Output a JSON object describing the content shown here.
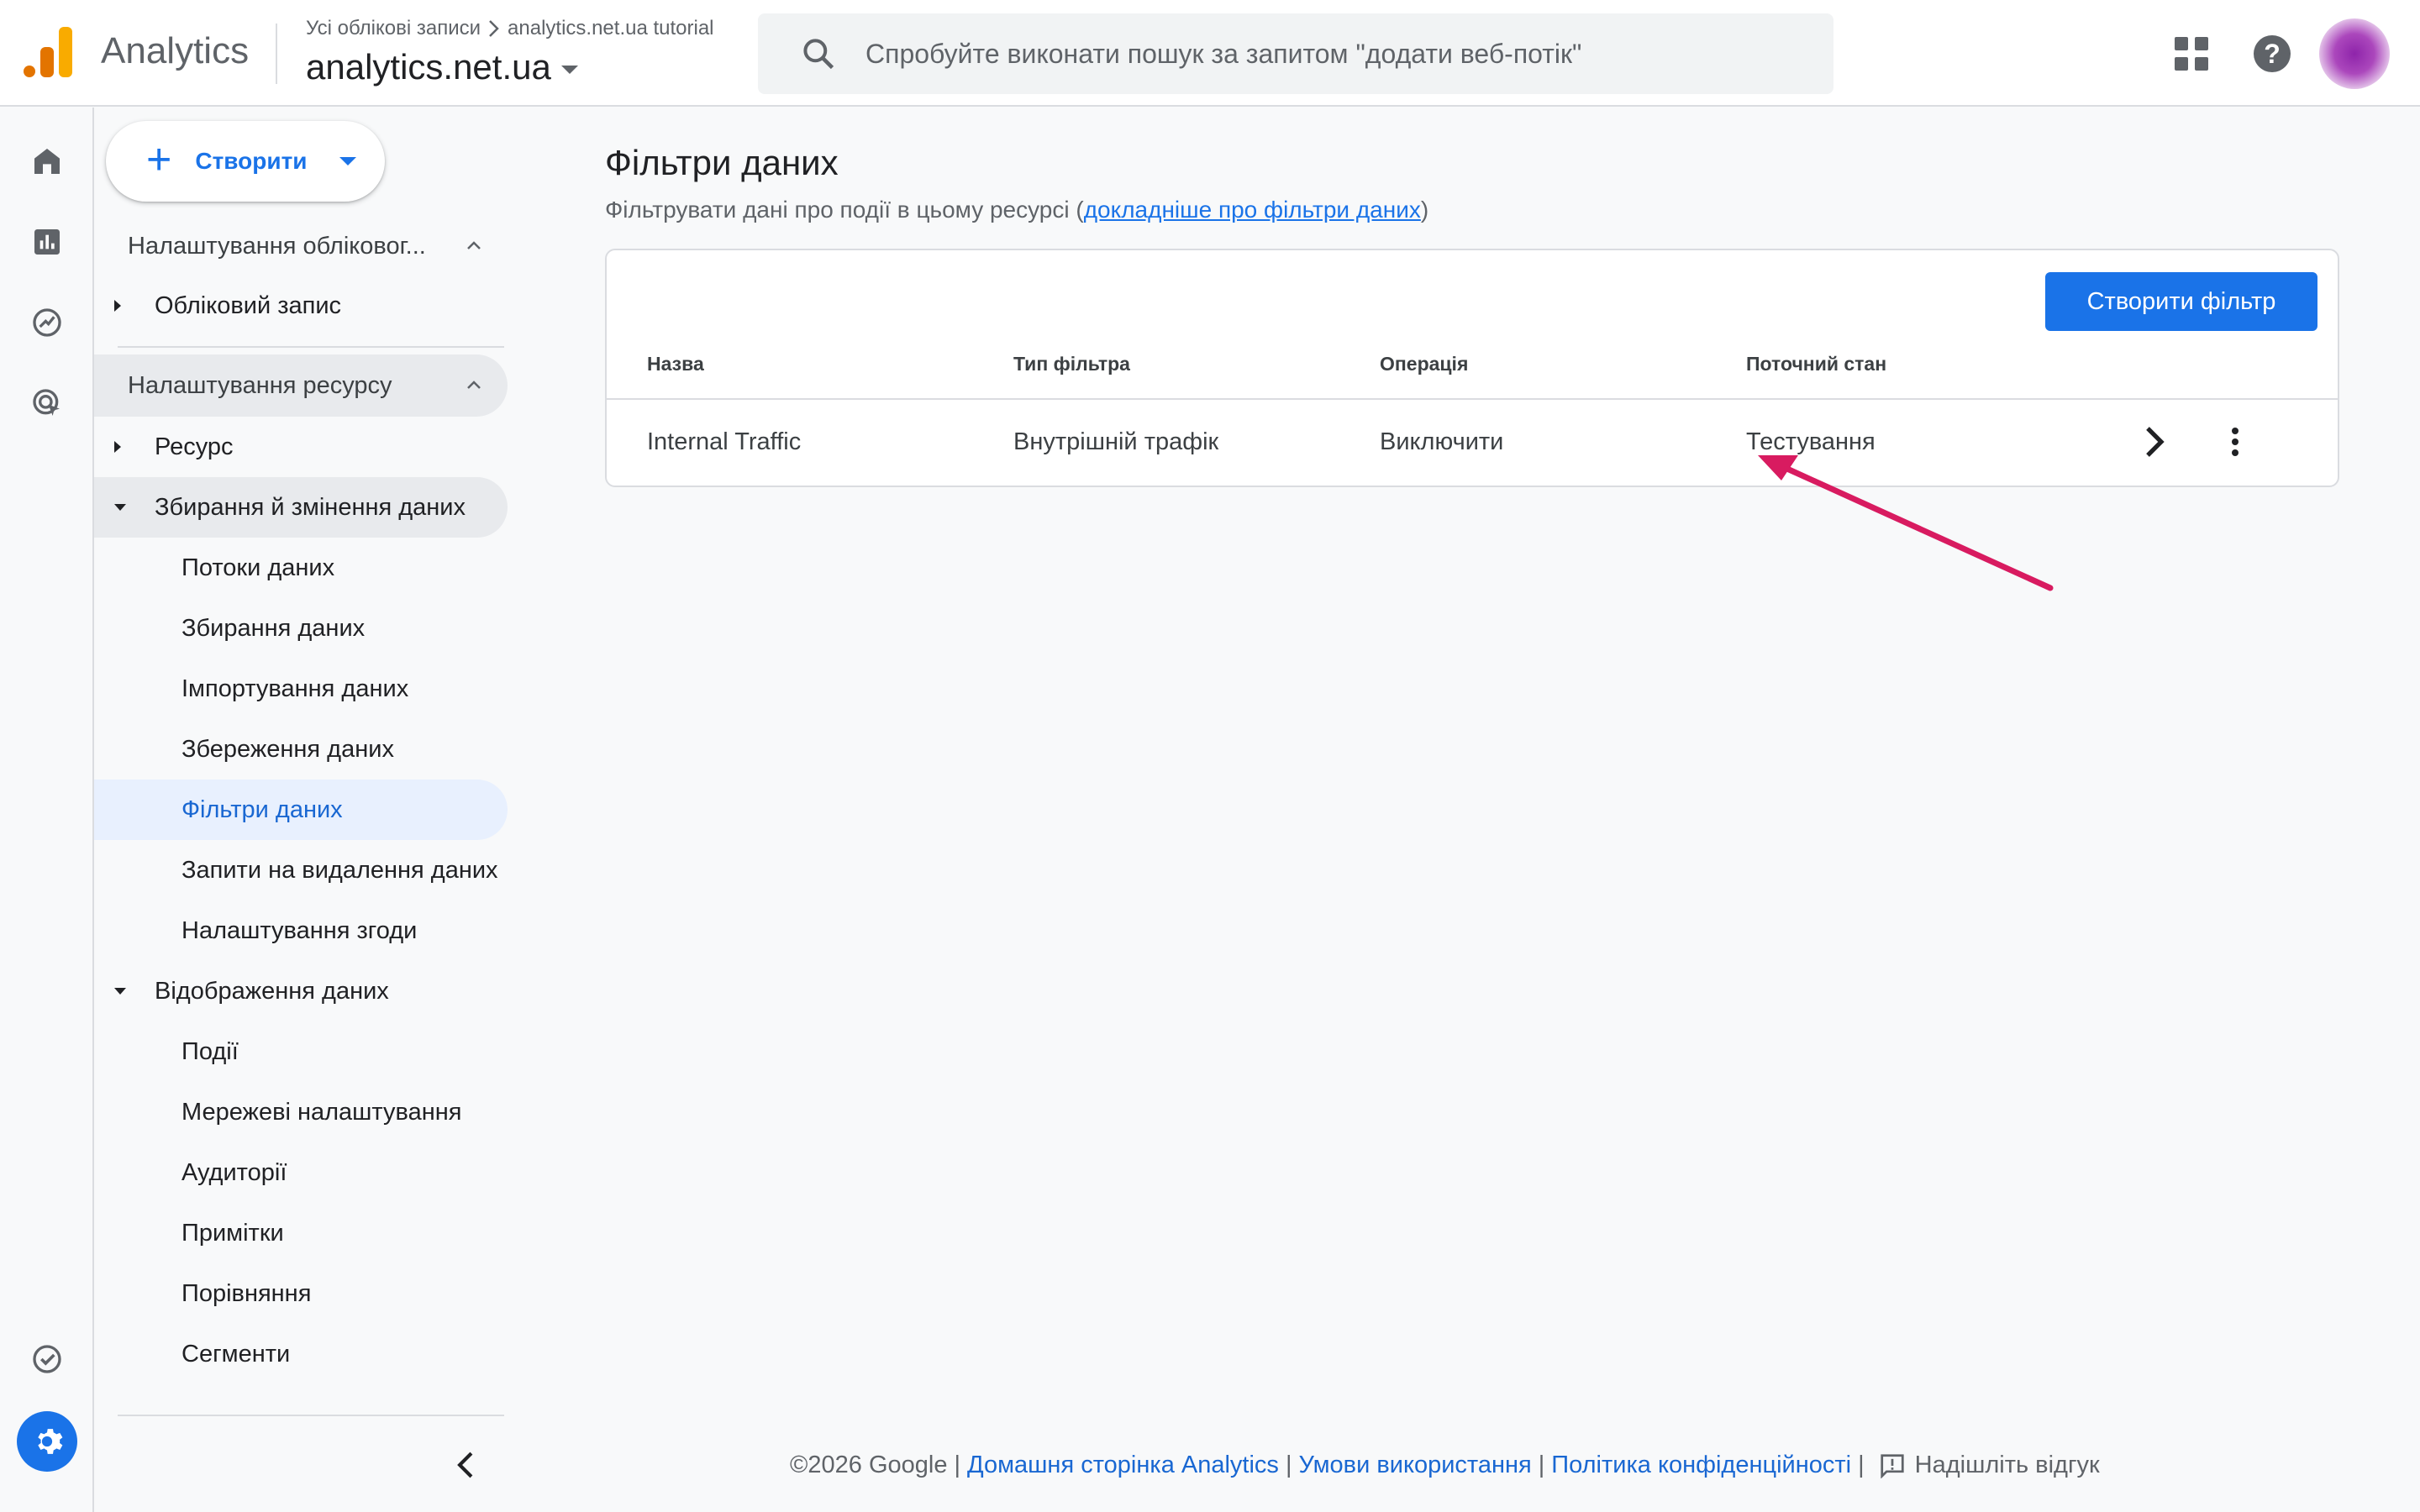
{
  "header": {
    "app_name": "Analytics",
    "breadcrumb_root": "Усі облікові записи",
    "breadcrumb_account": "analytics.net.ua tutorial",
    "property_name": "analytics.net.ua",
    "search_placeholder": "Спробуйте виконати пошук за запитом \"додати веб-потік\""
  },
  "rail": {
    "items": [
      "home-icon",
      "reports-icon",
      "explore-icon",
      "advertising-icon",
      "admin-check-icon",
      "settings-icon"
    ]
  },
  "sidenav": {
    "create_label": "Створити",
    "account_section": "Налаштування обліковог...",
    "account_item": "Обліковий запис",
    "property_section": "Налаштування ресурсу",
    "property_items": {
      "resource": "Ресурс",
      "collection": "Збирання й змінення даних",
      "streams": "Потоки даних",
      "data_collection": "Збирання даних",
      "import": "Імпортування даних",
      "retention": "Збереження даних",
      "filters": "Фільтри даних",
      "deletion": "Запити на видалення даних",
      "consent": "Налаштування згоди",
      "display": "Відображення даних",
      "events": "Події",
      "network": "Мережеві налаштування",
      "audiences": "Аудиторії",
      "annotations": "Примітки",
      "comparisons": "Порівняння",
      "segments": "Сегменти"
    }
  },
  "main": {
    "title": "Фільтри даних",
    "subtitle_prefix": "Фільтрувати дані про події в цьому ресурсі (",
    "subtitle_link": "докладніше про фільтри даних",
    "subtitle_suffix": ")",
    "create_filter_label": "Створити фільтр",
    "columns": [
      "Назва",
      "Тип фільтра",
      "Операція",
      "Поточний стан"
    ],
    "rows": [
      {
        "name": "Internal Traffic",
        "type": "Внутрішній трафік",
        "operation": "Виключити",
        "state": "Тестування"
      }
    ],
    "annotation_color": "#d81b60"
  },
  "footer": {
    "copyright": "©2026 Google",
    "home_link": "Домашня сторінка Analytics",
    "terms_link": "Умови використання",
    "privacy_link": "Політика конфіденційності",
    "feedback": "Надішліть відгук"
  },
  "colors": {
    "accent": "#1a73e8",
    "active_nav_bg": "#e8f0fe",
    "logo_orange": "#e37400",
    "logo_yellow": "#f9ab00"
  }
}
